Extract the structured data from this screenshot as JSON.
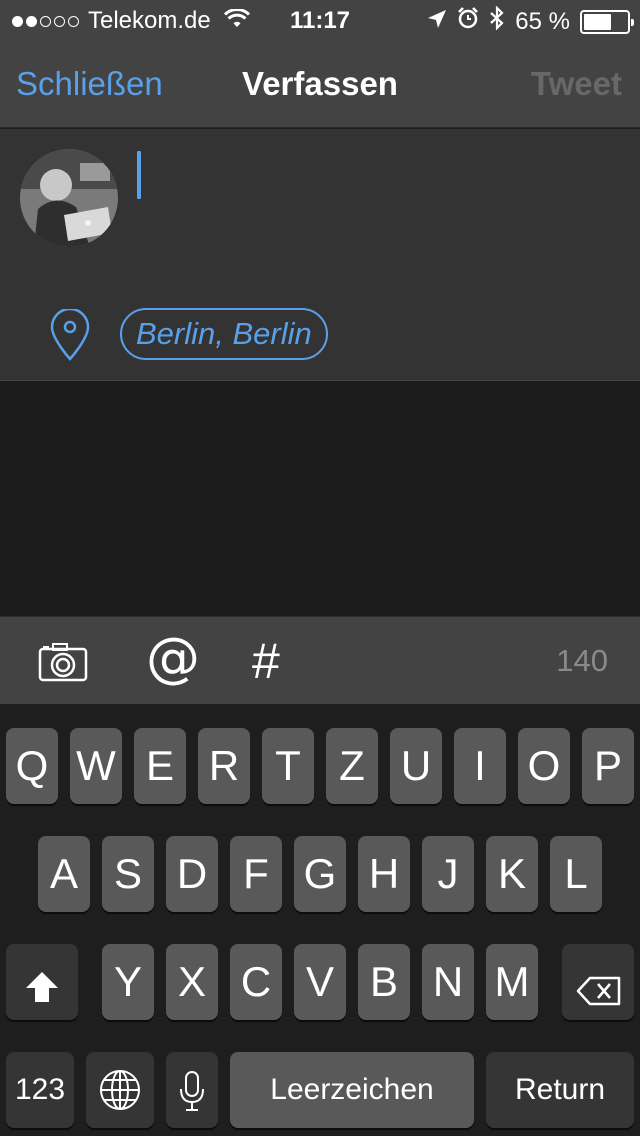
{
  "status_bar": {
    "carrier": "Telekom.de",
    "signal_dots_filled": 2,
    "signal_dots_total": 5,
    "time": "11:17",
    "battery_percent": "65 %",
    "battery_level": 0.65
  },
  "nav": {
    "close_label": "Schließen",
    "title": "Verfassen",
    "tweet_label": "Tweet"
  },
  "compose": {
    "text": "",
    "location": "Berlin, Berlin"
  },
  "toolbar": {
    "camera_icon": "camera-icon",
    "mention_symbol": "@",
    "hashtag_symbol": "#",
    "char_count": "140"
  },
  "keyboard": {
    "row1": [
      "Q",
      "W",
      "E",
      "R",
      "T",
      "Z",
      "U",
      "I",
      "O",
      "P"
    ],
    "row2": [
      "A",
      "S",
      "D",
      "F",
      "G",
      "H",
      "J",
      "K",
      "L"
    ],
    "row3": [
      "Y",
      "X",
      "C",
      "V",
      "B",
      "N",
      "M"
    ],
    "numbers_label": "123",
    "space_label": "Leerzeichen",
    "return_label": "Return"
  },
  "colors": {
    "accent": "#5aa0e8",
    "bar": "#434343",
    "compose_bg": "#333333"
  }
}
